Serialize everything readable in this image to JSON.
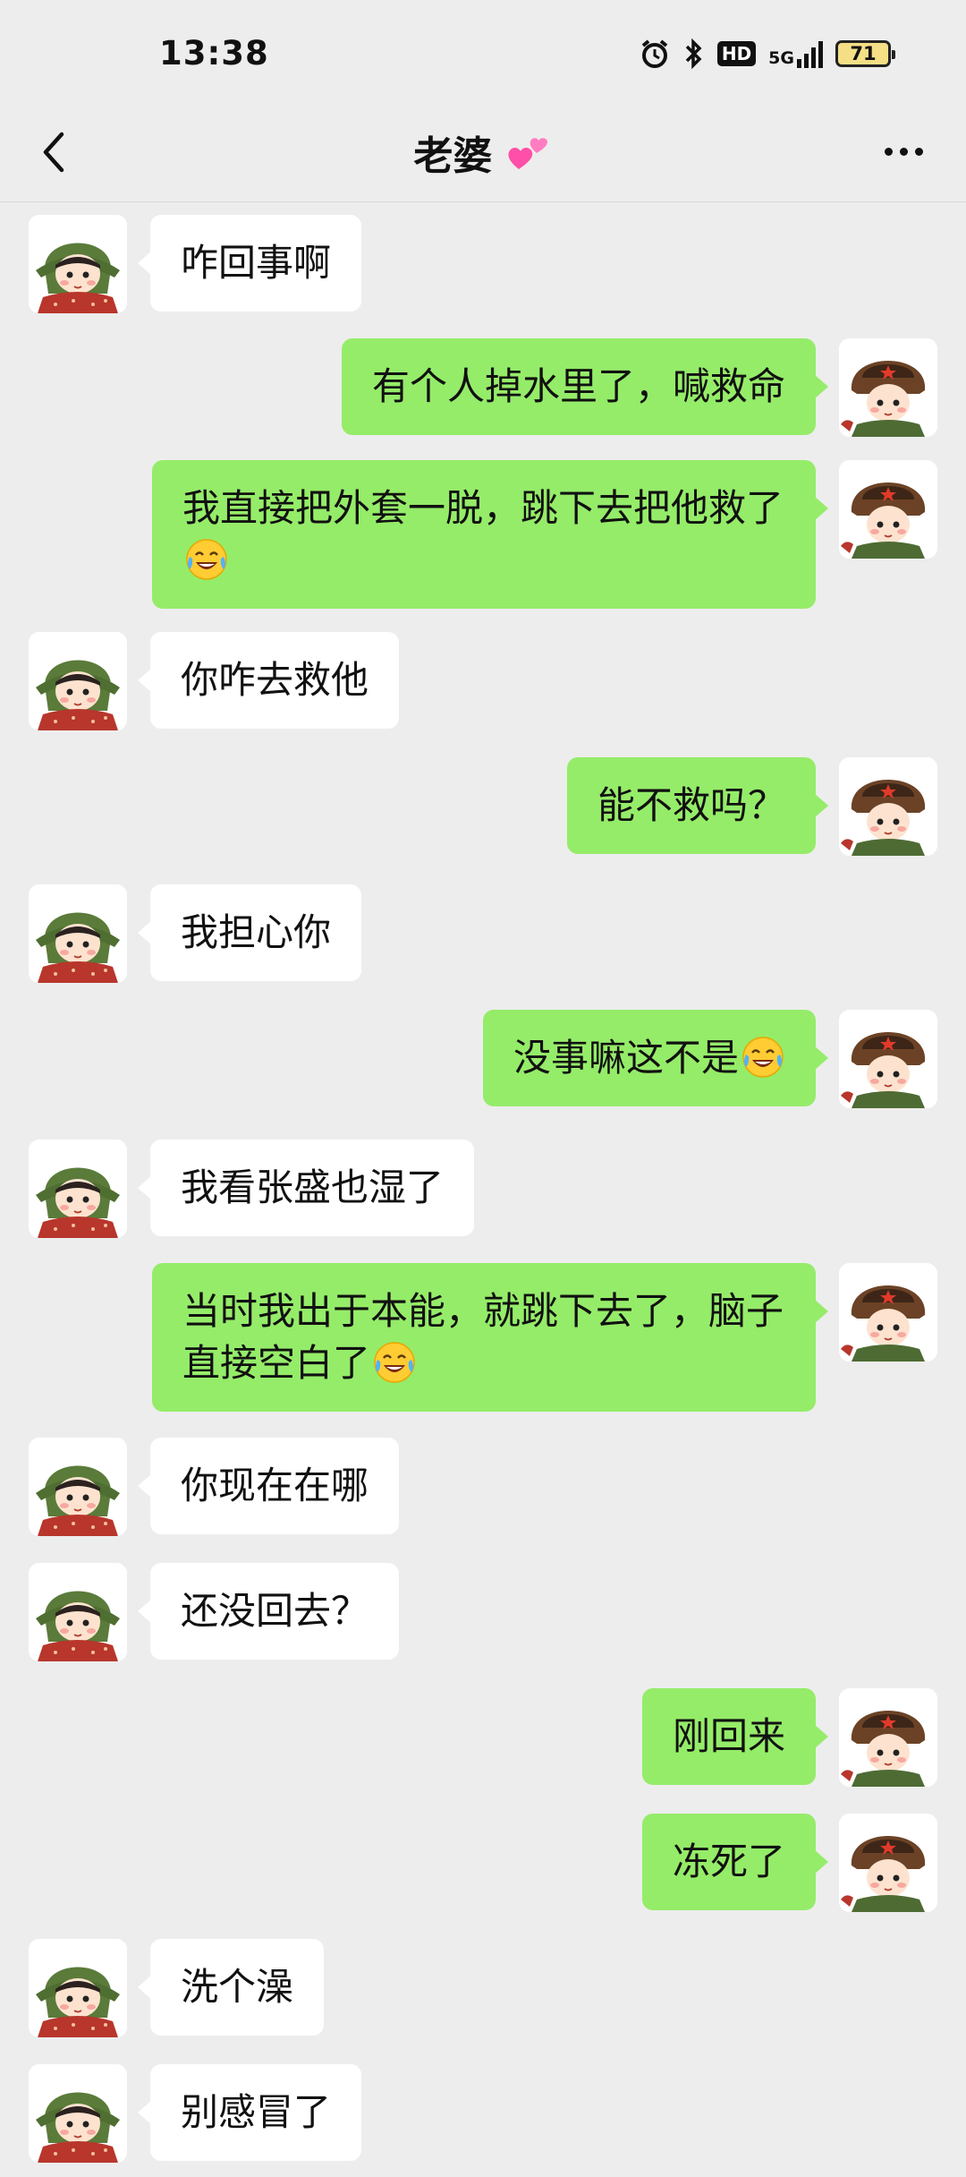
{
  "status_bar": {
    "time": "13:38",
    "network": "5G",
    "hd": "HD",
    "battery": "71"
  },
  "header": {
    "title": "老婆"
  },
  "messages": [
    {
      "side": "left",
      "text": "咋回事啊"
    },
    {
      "side": "right",
      "text": "有个人掉水里了，喊救命"
    },
    {
      "side": "right",
      "text": "我直接把外套一脱，跳下去把他救了",
      "emoji": "crying-laughing"
    },
    {
      "side": "left",
      "text": "你咋去救他"
    },
    {
      "side": "right",
      "text": "能不救吗？"
    },
    {
      "side": "left",
      "text": "我担心你"
    },
    {
      "side": "right",
      "text": "没事嘛这不是",
      "emoji": "crying-laughing"
    },
    {
      "side": "left",
      "text": "我看张盛也湿了"
    },
    {
      "side": "right",
      "text": "当时我出于本能，就跳下去了，脑子直接空白了",
      "emoji": "crying-laughing"
    },
    {
      "side": "left",
      "text": "你现在在哪"
    },
    {
      "side": "left",
      "text": "还没回去？"
    },
    {
      "side": "right",
      "text": "刚回来"
    },
    {
      "side": "right",
      "text": "冻死了"
    },
    {
      "side": "left",
      "text": "洗个澡"
    },
    {
      "side": "left",
      "text": "别感冒了"
    }
  ],
  "colors": {
    "background": "#ededed",
    "sent_bubble": "#95ec69",
    "received_bubble": "#ffffff"
  }
}
